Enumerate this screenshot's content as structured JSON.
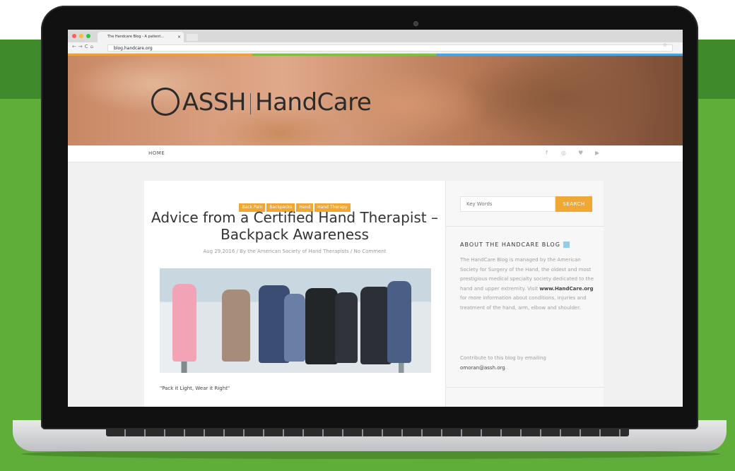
{
  "browser": {
    "tab_title": "The Handcare Blog - A patient...",
    "url": "blog.handcare.org"
  },
  "header": {
    "logo_left": "ASSH",
    "logo_right": "HandCare"
  },
  "menu": {
    "home": "HOME",
    "social": [
      "f",
      "◎",
      "♥",
      "▶"
    ]
  },
  "post": {
    "tags": [
      "Back Pain",
      "Backpacks",
      "Hand",
      "Hand Therapy"
    ],
    "title": "Advice from a Certified Hand Therapist – Backpack Awareness",
    "meta": "Aug 29,2016 / By the American Society of Hand Therapists / No Comment",
    "caption": "\"Pack it Light, Wear it Right\""
  },
  "sidebar": {
    "search_placeholder": "Key Words",
    "search_button": "SEARCH",
    "about_title": "ABOUT THE HANDCARE BLOG",
    "about_text_1": "The HandCare Blog is managed by the American Society for Surgery of the Hand, the oldest and most prestigious medical specialty society dedicated to the hand and upper extremity. Visit",
    "about_link": "www.HandCare.org",
    "about_text_2": "for more information about conditions, injuries and treatment of the hand, arm, elbow and shoulder.",
    "contribute_text": "Contribute to this blog by emailing",
    "contribute_email": "omoran@assh.org",
    "contribute_end": "."
  },
  "colors": {
    "background_green": "#5fae3a",
    "accent_orange": "#f0a733",
    "accent_blue": "#8fd0e8"
  }
}
